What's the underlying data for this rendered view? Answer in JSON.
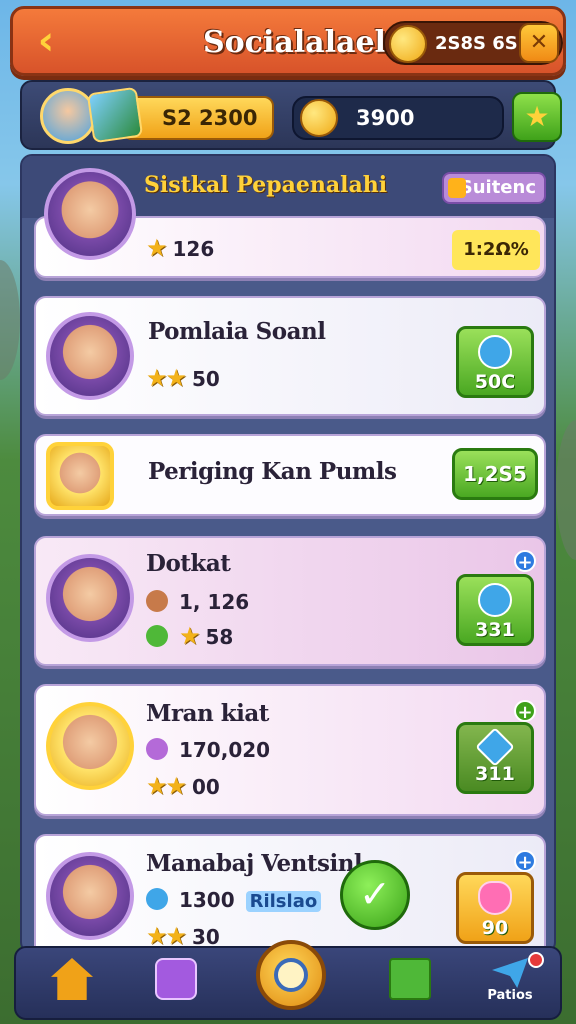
{
  "header": {
    "title": "Socialalael",
    "coins": "2S8S 6S",
    "back_icon": "chevron-left-icon",
    "action_icon": "swords-icon"
  },
  "currency": {
    "gold": "S2 2300",
    "coins": "3900"
  },
  "section": {
    "title": "Sistkal Pepaenalahi",
    "badge": "Suitenc",
    "top_card": {
      "stars_value": "126",
      "progress": "1:2Ω%"
    }
  },
  "players": [
    {
      "name": "Pomlaia Soanl",
      "stat": "50",
      "button": "50C"
    },
    {
      "name": "Periging Kan Pumls",
      "button": "1,2S5"
    },
    {
      "name": "Dotkat",
      "stat1": "1, 126",
      "stat2": "58",
      "button": "331"
    },
    {
      "name": "Mran kiat",
      "stat1": "170,020",
      "stat2": "00",
      "button": "311"
    },
    {
      "name": "Manabaj Ventsinl",
      "stat1": "1300",
      "badge": "Rilslao",
      "stat2": "30",
      "button": "90"
    }
  ],
  "nav": {
    "last_label": "Patios"
  },
  "colors": {
    "header": "#e6632e",
    "panel": "#4a5a8a",
    "accent_gold": "#ffd23a",
    "button_green": "#4aa822"
  }
}
